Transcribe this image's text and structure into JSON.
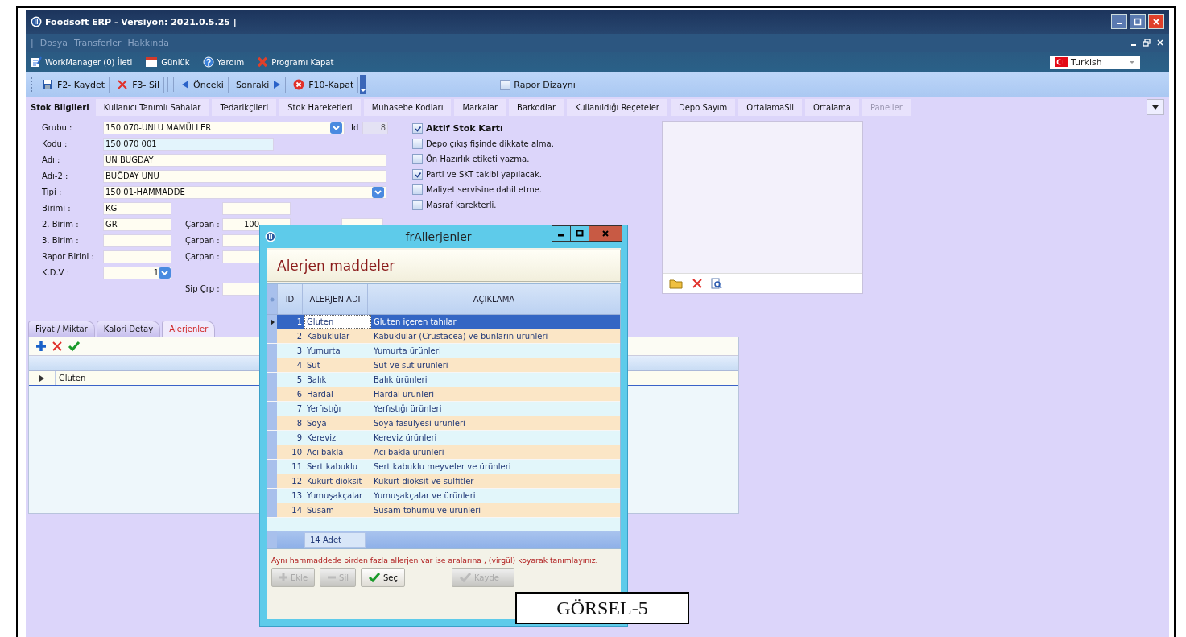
{
  "window": {
    "title": "Foodsoft ERP - Versiyon: 2021.0.5.25 |"
  },
  "menu_separator": "|",
  "menu": [
    "Dosya",
    "Transferler",
    "Hakkında"
  ],
  "quickbar": [
    {
      "label": "WorkManager (0) İleti",
      "kind": "notes"
    },
    {
      "label": "Günlük",
      "kind": "calendar"
    },
    {
      "label": "Yardım",
      "kind": "help"
    },
    {
      "label": "Programı Kapat",
      "kind": "exit"
    }
  ],
  "language": "Turkish",
  "toolbar": [
    {
      "label": "F2- Kaydet",
      "kind": "save"
    },
    {
      "label": "F3- Sil",
      "kind": "delete"
    },
    {
      "label": "Önceki",
      "kind": "prev"
    },
    {
      "label": "Sonraki",
      "kind": "next"
    },
    {
      "label": "F10-Kapat",
      "kind": "close"
    }
  ],
  "report_design": {
    "label": "Rapor Dizaynı",
    "checked": false
  },
  "tabs": [
    {
      "label": "Stok Bilgileri",
      "selected": true,
      "disabled": false
    },
    {
      "label": "Kullanıcı Tanımlı Sahalar",
      "selected": false,
      "disabled": false
    },
    {
      "label": "Tedarikçileri",
      "selected": false,
      "disabled": false
    },
    {
      "label": "Stok Hareketleri",
      "selected": false,
      "disabled": false
    },
    {
      "label": "Muhasebe Kodları",
      "selected": false,
      "disabled": false
    },
    {
      "label": "Markalar",
      "selected": false,
      "disabled": false
    },
    {
      "label": "Barkodlar",
      "selected": false,
      "disabled": false
    },
    {
      "label": "Kullanıldığı Reçeteler",
      "selected": false,
      "disabled": false
    },
    {
      "label": "Depo Sayım",
      "selected": false,
      "disabled": false
    },
    {
      "label": "OrtalamaSil",
      "selected": false,
      "disabled": false
    },
    {
      "label": "Ortalama",
      "selected": false,
      "disabled": false
    },
    {
      "label": "Paneller",
      "selected": false,
      "disabled": true
    }
  ],
  "form": [
    {
      "label": "Grubu :",
      "field": {
        "kind": "select",
        "value": "150 070-UNLU MAMÜLLER",
        "focused": false
      },
      "extras": [
        {
          "label": "Id",
          "field": {
            "kind": "readonly",
            "value": "8"
          }
        }
      ]
    },
    {
      "label": "Kodu :",
      "field": {
        "kind": "text",
        "value": "150 070 001",
        "focused": true
      }
    },
    {
      "label": "Adı :",
      "field": {
        "kind": "text",
        "value": "UN BUĞDAY",
        "focused": false
      }
    },
    {
      "label": "Adı-2 :",
      "field": {
        "kind": "text",
        "value": "BUĞDAY UNU",
        "focused": false
      }
    },
    {
      "label": "Tipi :",
      "field": {
        "kind": "select",
        "value": "150 01-HAMMADDE",
        "focused": false
      }
    },
    {
      "label": "Birimi :",
      "field": {
        "kind": "text",
        "value": "KG",
        "focused": false
      },
      "extras": [
        {
          "field": {
            "kind": "text"
          }
        }
      ]
    },
    {
      "label": "2. Birim :",
      "field": {
        "kind": "text",
        "value": "GR",
        "focused": false
      },
      "extras": [
        {
          "label": "Çarpan :",
          "field": {
            "kind": "number",
            "value": "100"
          }
        },
        {
          "field": {
            "kind": "text"
          }
        }
      ]
    },
    {
      "label": "3. Birim :",
      "field": {
        "kind": "text",
        "focused": false
      },
      "extras": [
        {
          "label": "Çarpan :",
          "field": {
            "kind": "text"
          }
        }
      ]
    },
    {
      "label": "Rapor Birini :",
      "field": {
        "kind": "text",
        "focused": false
      },
      "extras": [
        {
          "label": "Çarpan :",
          "field": {
            "kind": "text"
          }
        }
      ]
    },
    {
      "label": "K.D.V :",
      "field": {
        "kind": "spin",
        "value": "1",
        "focused": false
      }
    },
    {
      "extras": [
        {
          "label": "Sip Çrp :",
          "field": {
            "kind": "text"
          }
        }
      ]
    }
  ],
  "options": [
    {
      "label": "Aktif Stok Kartı",
      "checked": true,
      "kind": "main"
    },
    {
      "label": "Depo çıkış fişinde dikkate alma.",
      "checked": false,
      "kind": "option"
    },
    {
      "label": "Ön Hazırlık etiketi yazma.",
      "checked": false,
      "kind": "option"
    },
    {
      "label": "Parti ve SKT takibi yapılacak.",
      "checked": true,
      "kind": "option"
    },
    {
      "label": "Maliyet servisine dahil etme.",
      "checked": false,
      "kind": "option"
    },
    {
      "label": "Masraf karekterli.",
      "checked": false,
      "kind": "option"
    }
  ],
  "detail_tabs": [
    {
      "label": "Fiyat / Miktar",
      "selected": false
    },
    {
      "label": "Kalori Detay",
      "selected": false
    },
    {
      "label": "Alerjenler",
      "selected": true
    }
  ],
  "allergen_list": {
    "rows": [
      {
        "name": "Gluten",
        "current": true
      }
    ]
  },
  "dialog": {
    "title": "frAllerjenler",
    "heading": "Alerjen maddeler",
    "columns": [
      "ID",
      "ALERJEN ADI",
      "AÇIKLAMA"
    ],
    "rows": [
      {
        "id": "1",
        "name": "Gluten",
        "description": "Gluten içeren tahılar",
        "selected": true
      },
      {
        "id": "2",
        "name": "Kabuklular",
        "description": "Kabuklular (Crustacea) ve bunların ürünleri",
        "selected": false
      },
      {
        "id": "3",
        "name": "Yumurta",
        "description": "Yumurta ürünleri",
        "selected": false
      },
      {
        "id": "4",
        "name": "Süt",
        "description": "Süt ve süt ürünleri",
        "selected": false
      },
      {
        "id": "5",
        "name": "Balık",
        "description": "Balık ürünleri",
        "selected": false
      },
      {
        "id": "6",
        "name": "Hardal",
        "description": "Hardal ürünleri",
        "selected": false
      },
      {
        "id": "7",
        "name": "Yerfıstığı",
        "description": "Yerfıstığı ürünleri",
        "selected": false
      },
      {
        "id": "8",
        "name": "Soya",
        "description": "Soya fasulyesi ürünleri",
        "selected": false
      },
      {
        "id": "9",
        "name": "Kereviz",
        "description": "Kereviz ürünleri",
        "selected": false
      },
      {
        "id": "10",
        "name": "Acı bakla",
        "description": "Acı bakla ürünleri",
        "selected": false
      },
      {
        "id": "11",
        "name": "Sert kabuklu",
        "description": "Sert kabuklu meyveler ve ürünleri",
        "selected": false
      },
      {
        "id": "12",
        "name": "Kükürt dioksit",
        "description": "Kükürt dioksit ve sülfitler",
        "selected": false
      },
      {
        "id": "13",
        "name": "Yumuşakçalar",
        "description": "Yumuşakçalar ve ürünleri",
        "selected": false
      },
      {
        "id": "14",
        "name": "Susam",
        "description": "Susam tohumu ve ürünleri",
        "selected": false
      }
    ],
    "footer": "14 Adet",
    "note": "Aynı hammaddede birden fazla allerjen var ise aralarına , (virgül) koyarak tanımlayınız.",
    "buttons": [
      {
        "label": "Ekle",
        "kind": "add",
        "disabled": true
      },
      {
        "label": "Sil",
        "kind": "remove",
        "disabled": true
      },
      {
        "label": "Seç",
        "kind": "select",
        "disabled": false
      },
      {
        "label": "Kayde",
        "kind": "save",
        "disabled": true
      }
    ]
  },
  "caption": "GÖRSEL-5"
}
